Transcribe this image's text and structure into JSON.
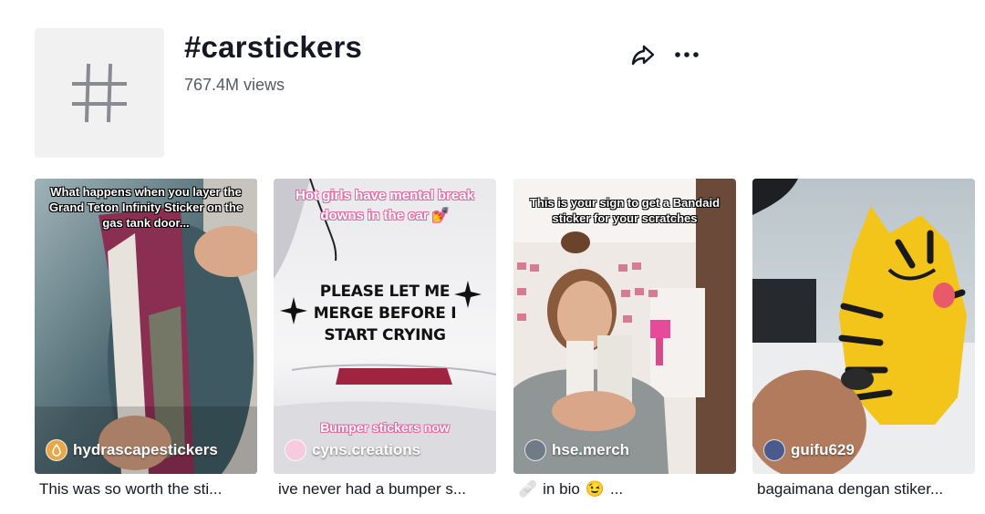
{
  "header": {
    "hashtag": "#carstickers",
    "views": "767.4M views",
    "share_icon": "share-arrow-icon",
    "more_icon": "more-dots-icon"
  },
  "videos": [
    {
      "overlay_text": "What happens when you layer the Grand Teton Infinity Sticker on the gas tank door...",
      "creator": "hydrascapestickers",
      "caption": "This was so worth the sti..."
    },
    {
      "overlay_text": "Hot girls have mental break downs in the car 💅",
      "sticker_text": "PLEASE LET ME MERGE BEFORE I START CRYING",
      "bottom_text": "Bumper stickers now",
      "creator": "cyns.creations",
      "caption": "ive never had a bumper s..."
    },
    {
      "overlay_text": "This is your sign to get a Bandaid sticker for your scratches",
      "creator": "hse.merch",
      "caption_icon": "🩹",
      "caption": "in bio",
      "caption_emoji": "😉",
      "caption_tail": "..."
    },
    {
      "creator": "guifu629",
      "caption": "bagaimana dengan stiker..."
    }
  ],
  "colors": {
    "title": "#161823",
    "secondary_text": "#555a63",
    "avatar_bg": "#f1f1f2",
    "overlay_pink": "#e36aa5"
  }
}
